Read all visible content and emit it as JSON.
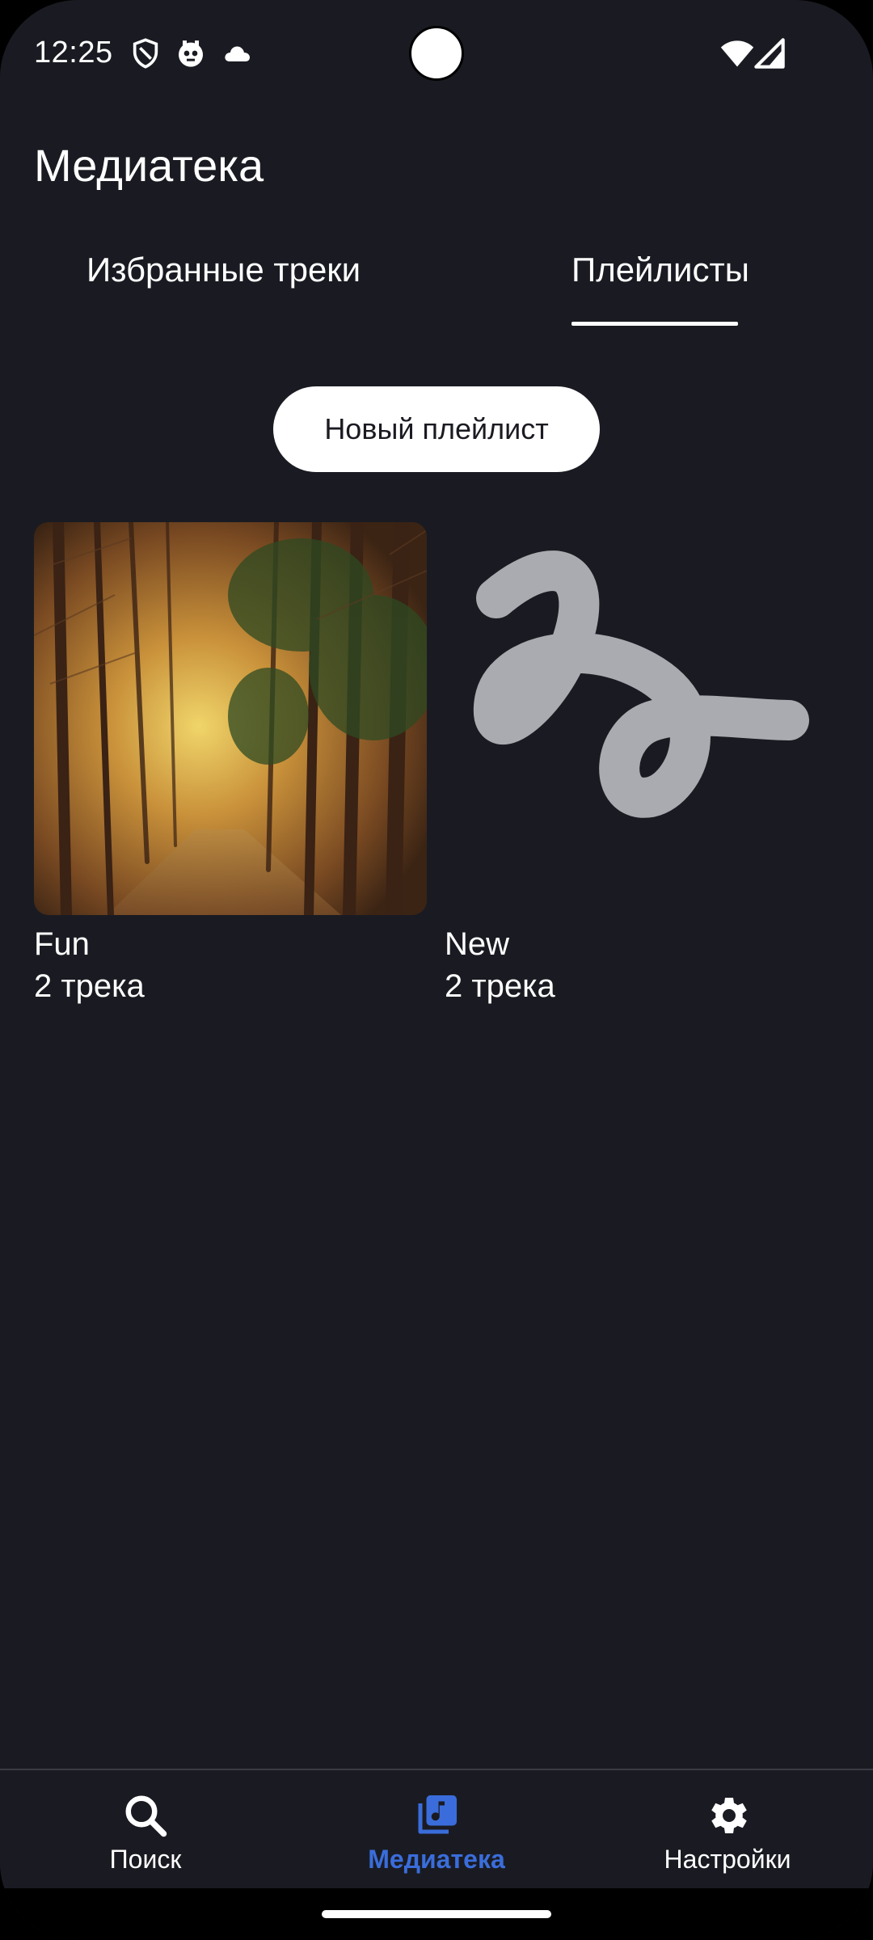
{
  "status_bar": {
    "time": "12:25",
    "icons": [
      "shield-icon",
      "notification-bot-icon",
      "cloud-icon",
      "wifi-icon",
      "cellular-signal-icon"
    ]
  },
  "header": {
    "title": "Медиатека"
  },
  "tabs": [
    {
      "label": "Избранные треки",
      "selected": false
    },
    {
      "label": "Плейлисты",
      "selected": true
    }
  ],
  "actions": {
    "new_playlist_label": "Новый плейлист"
  },
  "playlists": [
    {
      "title": "Fun",
      "count": "2 трека",
      "cover": "forest-photo"
    },
    {
      "title": "New",
      "count": "2 трека",
      "cover": "placeholder-squiggle-icon"
    }
  ],
  "bottom_nav": {
    "items": [
      {
        "label": "Поиск",
        "icon": "search-icon",
        "active": false
      },
      {
        "label": "Медиатека",
        "icon": "music-library-icon",
        "active": true
      },
      {
        "label": "Настройки",
        "icon": "gear-icon",
        "active": false
      }
    ]
  },
  "colors": {
    "background": "#1a1b22",
    "accent": "#3a6ddb",
    "text": "#ffffff",
    "placeholder": "#a9abb0"
  }
}
